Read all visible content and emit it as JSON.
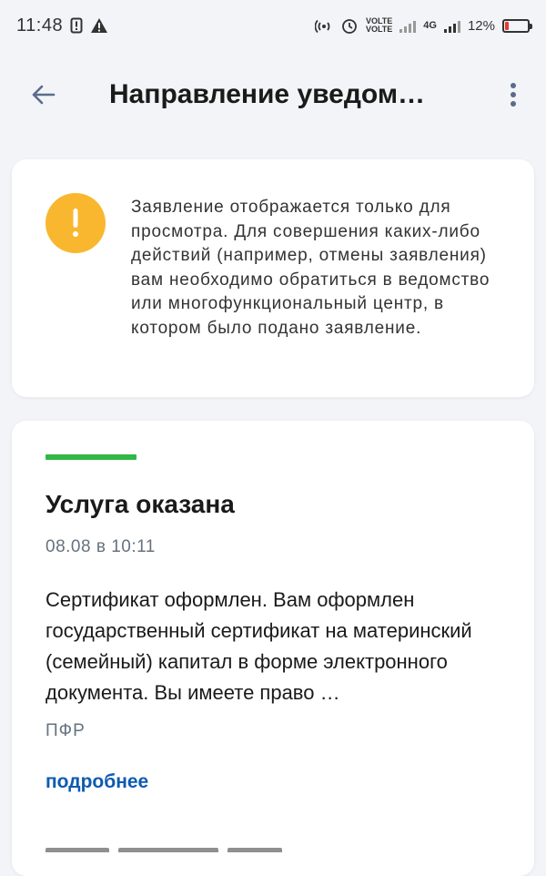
{
  "status_bar": {
    "time": "11:48",
    "volte1": "VOLTE",
    "volte2": "VOLTE",
    "net": "4G",
    "battery_pct": "12%",
    "battery_level": 0.12,
    "battery_color": "#e53935",
    "icons": [
      "notification-icon",
      "warning-triangle-icon",
      "hotspot-icon",
      "alarm-icon",
      "signal-icon",
      "battery-icon"
    ]
  },
  "app_bar": {
    "title": "Направление уведом…",
    "back_icon": "arrow-left-icon",
    "more_icon": "more-vertical-icon"
  },
  "notice": {
    "icon": "exclamation-icon",
    "icon_color": "#f9b72f",
    "text": "Заявление отображается только для просмотра. Для совершения каких-либо действий (например, отмены заявления) вам необходимо обратиться в ведомство или многофункциональный центр, в котором было подано заявление."
  },
  "status_item": {
    "accent_color": "#2fb846",
    "title": "Услуга оказана",
    "date": "08.08 в 10:11",
    "description": "Сертификат оформлен. Вам оформлен государственный сертификат на материнский (семейный) капитал в форме электронного документа. Вы имеете право …",
    "organization": "ПФР",
    "more_link": "подробнее",
    "link_color": "#0d5bb0"
  }
}
